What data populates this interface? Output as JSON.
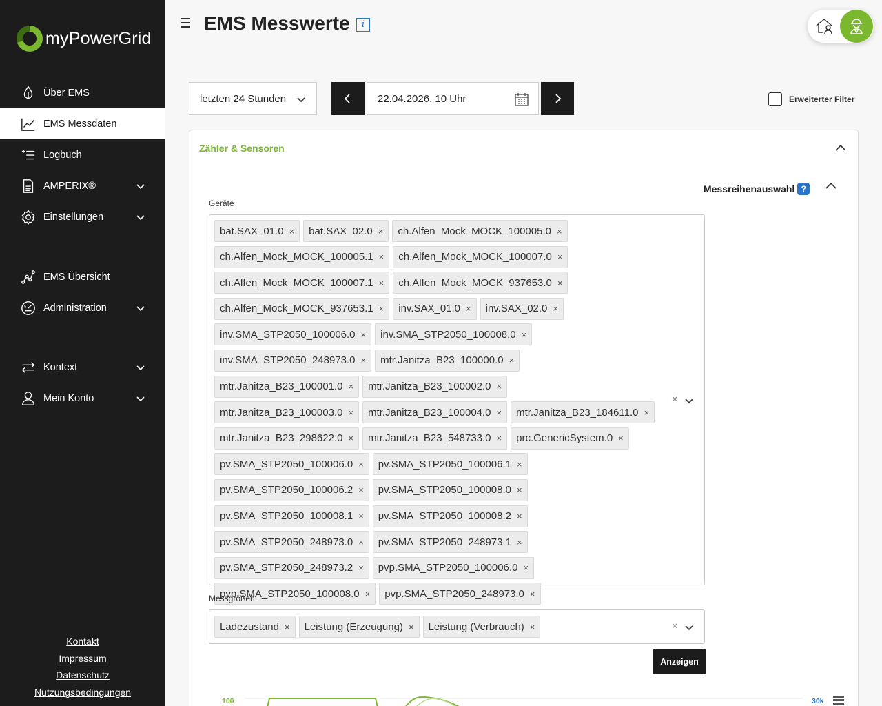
{
  "brand": {
    "name": "myPowerGrid"
  },
  "sidebar": {
    "items": [
      {
        "label": "Über EMS",
        "icon": "leaf-drop-icon"
      },
      {
        "label": "EMS Messdaten",
        "icon": "line-chart-icon",
        "active": true
      },
      {
        "label": "Logbuch",
        "icon": "list-add-icon"
      },
      {
        "label": "AMPERIX®",
        "icon": "document-icon",
        "expandable": true
      },
      {
        "label": "Einstellungen",
        "icon": "gear-icon",
        "expandable": true
      },
      {
        "label": "EMS Übersicht",
        "icon": "network-graph-icon"
      },
      {
        "label": "Administration",
        "icon": "admin-gauge-icon",
        "expandable": true
      },
      {
        "label": "Kontext",
        "icon": "switch-arrows-icon",
        "expandable": true
      },
      {
        "label": "Mein Konto",
        "icon": "user-icon",
        "expandable": true
      }
    ],
    "footer": [
      "Kontakt",
      "Impressum",
      "Datenschutz",
      "Nutzungsbedingungen"
    ]
  },
  "header": {
    "title": "EMS Messwerte",
    "info_glyph": "i"
  },
  "filters": {
    "range": "letzten 24 Stunden",
    "date": "22.04.2026, 10 Uhr",
    "extended_filter_label": "Erweiterter Filter",
    "extended_filter_checked": false
  },
  "panel": {
    "title": "Zähler & Sensoren",
    "series_selection_label": "Messreihenauswahl",
    "help_glyph": "?",
    "devices_label": "Geräte",
    "devices": [
      "bat.SAX_01.0",
      "bat.SAX_02.0",
      "ch.Alfen_Mock_MOCK_100005.0",
      "ch.Alfen_Mock_MOCK_100005.1",
      "ch.Alfen_Mock_MOCK_100007.0",
      "ch.Alfen_Mock_MOCK_100007.1",
      "ch.Alfen_Mock_MOCK_937653.0",
      "ch.Alfen_Mock_MOCK_937653.1",
      "inv.SAX_01.0",
      "inv.SAX_02.0",
      "inv.SMA_STP2050_100006.0",
      "inv.SMA_STP2050_100008.0",
      "inv.SMA_STP2050_248973.0",
      "mtr.Janitza_B23_100000.0",
      "mtr.Janitza_B23_100001.0",
      "mtr.Janitza_B23_100002.0",
      "mtr.Janitza_B23_100003.0",
      "mtr.Janitza_B23_100004.0",
      "mtr.Janitza_B23_184611.0",
      "mtr.Janitza_B23_298622.0",
      "mtr.Janitza_B23_548733.0",
      "prc.GenericSystem.0",
      "pv.SMA_STP2050_100006.0",
      "pv.SMA_STP2050_100006.1",
      "pv.SMA_STP2050_100006.2",
      "pv.SMA_STP2050_100008.0",
      "pv.SMA_STP2050_100008.1",
      "pv.SMA_STP2050_100008.2",
      "pv.SMA_STP2050_248973.0",
      "pv.SMA_STP2050_248973.1",
      "pv.SMA_STP2050_248973.2",
      "pvp.SMA_STP2050_100006.0",
      "pvp.SMA_STP2050_100008.0",
      "pvp.SMA_STP2050_248973.0"
    ],
    "measures_label": "Messgrößen",
    "measures": [
      "Ladezustand",
      "Leistung (Erzeugung)",
      "Leistung (Verbrauch)"
    ],
    "show_button": "Anzeigen",
    "clear_glyph": "×",
    "remove_glyph": "×"
  },
  "chart": {
    "left_axis_top": "100",
    "right_axis_top": "30k",
    "colors": {
      "left": "#7cb82f",
      "right": "#2a74c9"
    }
  },
  "colors": {
    "accent": "#7cb82f",
    "sidebar": "#1c1c1c",
    "info": "#2a74c9"
  }
}
